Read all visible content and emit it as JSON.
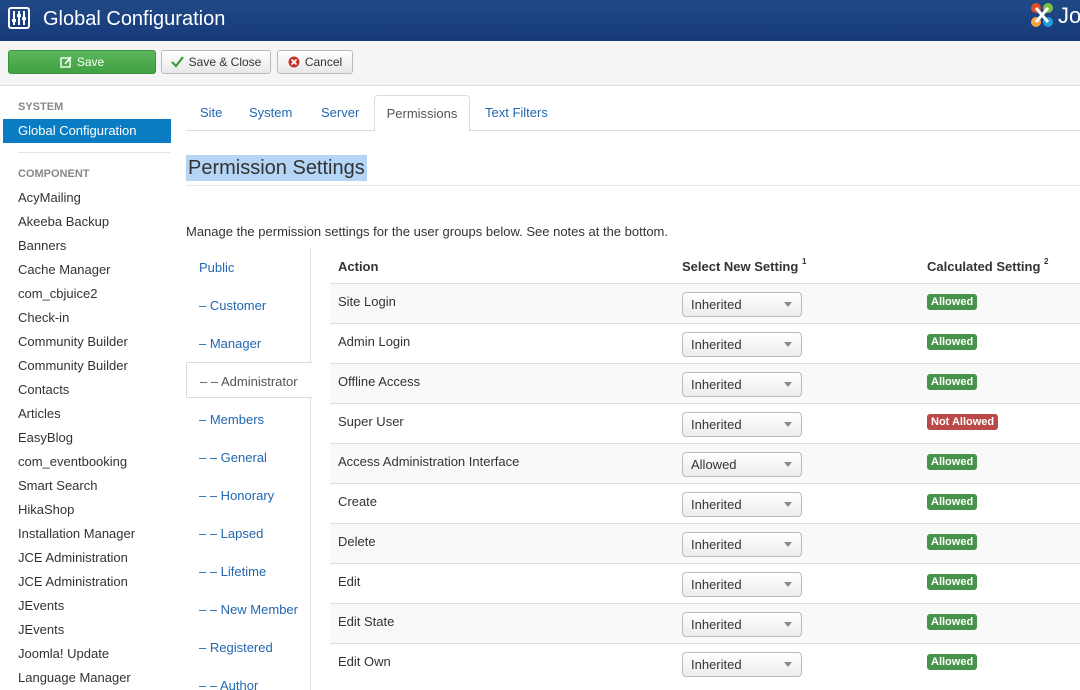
{
  "header": {
    "title": "Global Configuration",
    "logo_text": "Jo"
  },
  "toolbar": {
    "save": "Save",
    "save_close": "Save & Close",
    "cancel": "Cancel"
  },
  "sidebar": {
    "system_heading": "System",
    "active": "Global Configuration",
    "component_heading": "Component",
    "items": [
      "AcyMailing",
      "Akeeba Backup",
      "Banners",
      "Cache Manager",
      "com_cbjuice2",
      "Check-in",
      "Community Builder",
      "Community Builder",
      "Contacts",
      "Articles",
      "EasyBlog",
      "com_eventbooking",
      "Smart Search",
      "HikaShop",
      "Installation Manager",
      "JCE Administration",
      "JCE Administration",
      "JEvents",
      "JEvents",
      "Joomla! Update",
      "Language Manager"
    ]
  },
  "tabs": [
    "Site",
    "System",
    "Server",
    "Permissions",
    "Text Filters"
  ],
  "main": {
    "title": "Permission Settings",
    "description": "Manage the permission settings for the user groups below. See notes at the bottom."
  },
  "groups": [
    "Public",
    "– Customer",
    "– Manager",
    "– – Administrator",
    "– Members",
    "– – General",
    "– – Honorary",
    "– – Lapsed",
    "– – Lifetime",
    "– – New Member",
    "– Registered",
    "– – Author"
  ],
  "table": {
    "headers": {
      "action": "Action",
      "select": "Select New Setting",
      "select_note": "1",
      "calc": "Calculated Setting",
      "calc_note": "2"
    },
    "rows": [
      {
        "action": "Site Login",
        "setting": "Inherited",
        "calc": "Allowed",
        "allowed": true
      },
      {
        "action": "Admin Login",
        "setting": "Inherited",
        "calc": "Allowed",
        "allowed": true
      },
      {
        "action": "Offline Access",
        "setting": "Inherited",
        "calc": "Allowed",
        "allowed": true
      },
      {
        "action": "Super User",
        "setting": "Inherited",
        "calc": "Not Allowed",
        "allowed": false
      },
      {
        "action": "Access Administration Interface",
        "setting": "Allowed",
        "calc": "Allowed",
        "allowed": true
      },
      {
        "action": "Create",
        "setting": "Inherited",
        "calc": "Allowed",
        "allowed": true
      },
      {
        "action": "Delete",
        "setting": "Inherited",
        "calc": "Allowed",
        "allowed": true
      },
      {
        "action": "Edit",
        "setting": "Inherited",
        "calc": "Allowed",
        "allowed": true
      },
      {
        "action": "Edit State",
        "setting": "Inherited",
        "calc": "Allowed",
        "allowed": true
      },
      {
        "action": "Edit Own",
        "setting": "Inherited",
        "calc": "Allowed",
        "allowed": true
      }
    ]
  },
  "colors": {
    "header": "#1f4a86",
    "accent": "#0a7cc4",
    "save": "#5bb75b",
    "allowed": "#46944a",
    "not_allowed": "#b94a48"
  }
}
